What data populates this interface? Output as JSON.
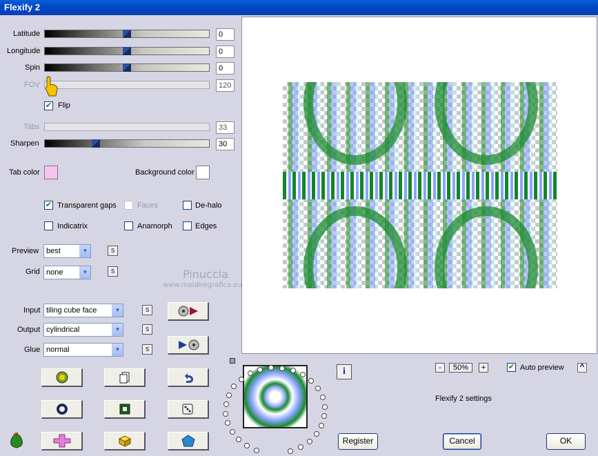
{
  "window": {
    "title": "Flexify 2"
  },
  "sliders": {
    "latitude": {
      "label": "Latitude",
      "value": "0"
    },
    "longitude": {
      "label": "Longitude",
      "value": "0"
    },
    "spin": {
      "label": "Spin",
      "value": "0"
    },
    "fov": {
      "label": "FOV",
      "value": "120"
    },
    "tabs": {
      "label": "Tabs",
      "value": "33"
    },
    "sharpen": {
      "label": "Sharpen",
      "value": "30"
    }
  },
  "flip": {
    "label": "Flip",
    "checked": true
  },
  "colors": {
    "tab_color_label": "Tab color",
    "tab_color": "#f7c4f0",
    "background_color_label": "Background color",
    "background_color": "#ffffff"
  },
  "options": {
    "transparent_gaps": "Transparent gaps",
    "faces": "Faces",
    "de_halo": "De-halo",
    "indicatrix": "Indicatrix",
    "anamorph": "Anamorph",
    "edges": "Edges"
  },
  "preview": {
    "label": "Preview",
    "value": "best"
  },
  "grid": {
    "label": "Grid",
    "value": "none"
  },
  "input": {
    "label": "Input",
    "value": "tiling cube face"
  },
  "output": {
    "label": "Output",
    "value": "cylindrical"
  },
  "glue": {
    "label": "Glue",
    "value": "normal"
  },
  "watermark": {
    "name": "Pinuccia",
    "url": "www.maidiregrafica.eu"
  },
  "small_button_label": "S",
  "zoom": {
    "minus": "-",
    "value": "50%",
    "plus": "+"
  },
  "auto_preview": {
    "label": "Auto preview",
    "checked": true,
    "toggle": "^"
  },
  "settings_name": "Flexify 2 settings",
  "info_label": "i",
  "buttons": {
    "register": "Register",
    "cancel": "Cancel",
    "ok": "OK"
  }
}
